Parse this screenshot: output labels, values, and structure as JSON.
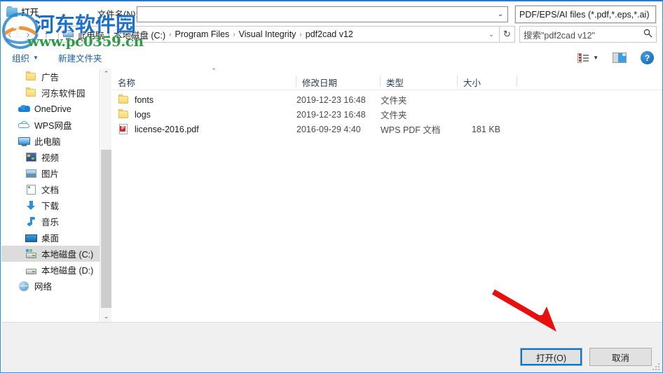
{
  "window": {
    "title": "打开",
    "title_icon": "folder-open-icon",
    "close_label": "✕"
  },
  "nav": {
    "back_label": "‹",
    "forward_label": "›",
    "up_label": "↑",
    "refresh_label": "↻",
    "address_chevron": "⌄",
    "breadcrumbs": [
      {
        "label": "此电脑",
        "icon": "this-pc-icon"
      },
      {
        "label": "本地磁盘 (C:)",
        "icon": ""
      },
      {
        "label": "Program Files",
        "icon": ""
      },
      {
        "label": "Visual Integrity",
        "icon": ""
      },
      {
        "label": "pdf2cad v12",
        "icon": ""
      }
    ],
    "separator": "›"
  },
  "search": {
    "value": "搜索\"pdf2cad v12\"",
    "placeholder": "搜索\"pdf2cad v12\"",
    "icon": "search-icon"
  },
  "commandbar": {
    "organize_label": "组织",
    "organize_caret": "▼",
    "new_folder_label": "新建文件夹",
    "view_icon": "list-view-icon",
    "view_caret": "▼",
    "preview_pane_icon": "preview-pane-icon",
    "help_icon": "help-icon",
    "help_label": "?"
  },
  "navpane": {
    "scroll_up": "⌃",
    "scroll_down": "⌄",
    "items": [
      {
        "label": "广告",
        "icon": "folder-icon",
        "kind": "folder",
        "indent": true,
        "selected": false
      },
      {
        "label": "河东软件园",
        "icon": "folder-icon",
        "kind": "folder",
        "indent": true,
        "selected": false
      },
      {
        "label": "OneDrive",
        "icon": "onedrive-icon",
        "kind": "onedrive",
        "indent": false,
        "selected": false
      },
      {
        "label": "WPS网盘",
        "icon": "wps-cloud-icon",
        "kind": "wps",
        "indent": false,
        "selected": false
      },
      {
        "label": "此电脑",
        "icon": "this-pc-icon",
        "kind": "pc",
        "indent": false,
        "selected": false
      },
      {
        "label": "视频",
        "icon": "videos-icon",
        "kind": "video",
        "indent": true,
        "selected": false
      },
      {
        "label": "图片",
        "icon": "pictures-icon",
        "kind": "pic",
        "indent": true,
        "selected": false
      },
      {
        "label": "文档",
        "icon": "documents-icon",
        "kind": "doc",
        "indent": true,
        "selected": false
      },
      {
        "label": "下载",
        "icon": "downloads-icon",
        "kind": "dl",
        "indent": true,
        "selected": false
      },
      {
        "label": "音乐",
        "icon": "music-icon",
        "kind": "music",
        "indent": true,
        "selected": false
      },
      {
        "label": "桌面",
        "icon": "desktop-icon",
        "kind": "desk",
        "indent": true,
        "selected": false
      },
      {
        "label": "本地磁盘 (C:)",
        "icon": "local-disk-icon",
        "kind": "drive",
        "indent": true,
        "selected": true
      },
      {
        "label": "本地磁盘 (D:)",
        "icon": "local-disk-icon",
        "kind": "drive2",
        "indent": true,
        "selected": false
      },
      {
        "label": "网络",
        "icon": "network-icon",
        "kind": "net",
        "indent": false,
        "selected": false
      }
    ]
  },
  "filelist": {
    "sort_indicator": "⌃",
    "columns": [
      "名称",
      "修改日期",
      "类型",
      "大小"
    ],
    "rows": [
      {
        "name": "fonts",
        "date": "2019-12-23 16:48",
        "type": "文件夹",
        "size": "",
        "icon": "folder-icon"
      },
      {
        "name": "logs",
        "date": "2019-12-23 16:48",
        "type": "文件夹",
        "size": "",
        "icon": "folder-icon"
      },
      {
        "name": "license-2016.pdf",
        "date": "2016-09-29 4:40",
        "type": "WPS PDF 文档",
        "size": "181 KB",
        "icon": "pdf-file-icon"
      }
    ]
  },
  "footer": {
    "filename_label": "文件名(N):",
    "filename_value": "",
    "filename_placeholder": "",
    "filename_caret": "⌄",
    "filetype_value": "PDF/EPS/AI files (*.pdf,*.eps,*.ai)",
    "open_label": "打开(O)",
    "cancel_label": "取消"
  },
  "annotation": {
    "arrow_color": "#e8100f",
    "points_to": "filetype-combo"
  },
  "watermark": {
    "title": "河东软件园",
    "url": "www.pc0359.cn",
    "title_color": "#1f6fc4",
    "url_color": "#2f9a4a"
  }
}
